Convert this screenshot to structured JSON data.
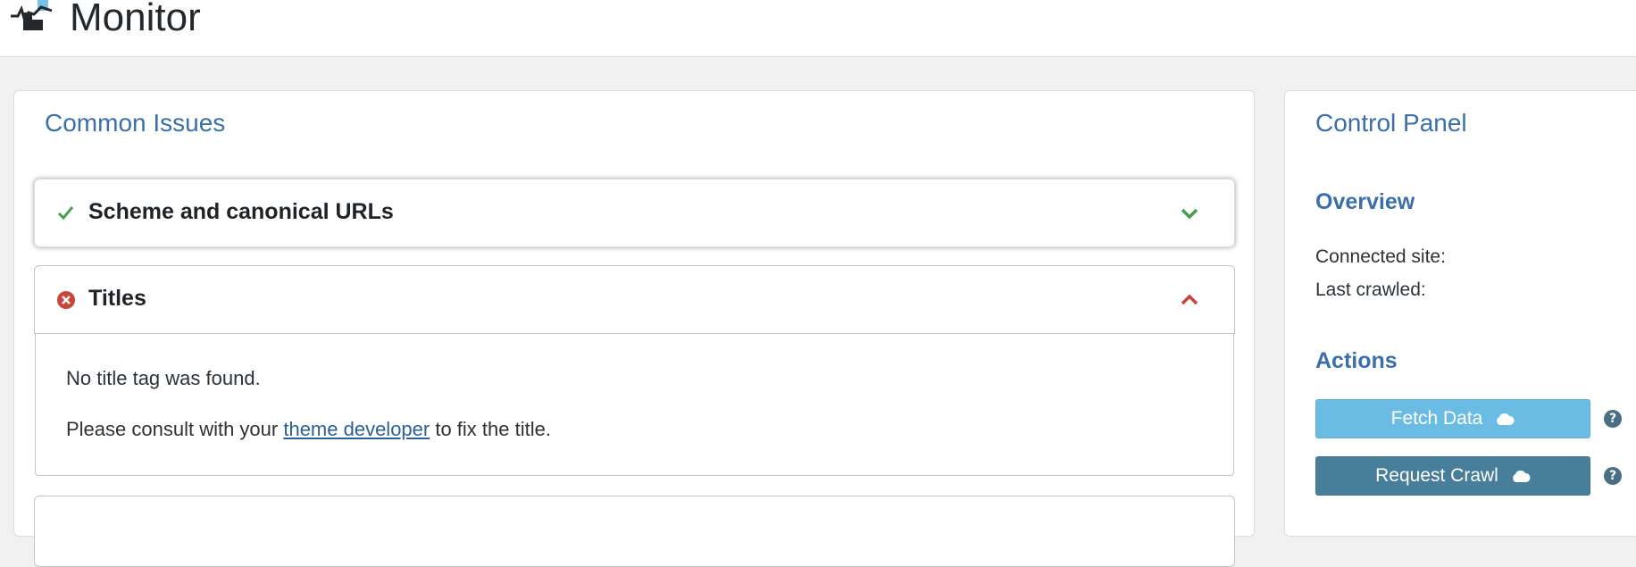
{
  "header": {
    "title": "Monitor"
  },
  "issues_card": {
    "title": "Common Issues",
    "items": [
      {
        "label": "Scheme and canonical URLs",
        "status": "pass",
        "status_icon": "check-icon",
        "chevron": "chevron-down-icon"
      },
      {
        "label": "Titles",
        "status": "fail",
        "status_icon": "error-circle-icon",
        "chevron": "chevron-up-icon"
      }
    ],
    "expanded_body": {
      "line1": "No title tag was found.",
      "line2_before": "Please consult with your ",
      "line2_link": "theme developer",
      "line2_after": " to fix the title."
    }
  },
  "control_panel": {
    "title": "Control Panel",
    "overview": {
      "heading": "Overview",
      "connected_site_label": "Connected site:",
      "last_crawled_label": "Last crawled:"
    },
    "actions": {
      "heading": "Actions",
      "fetch_label": "Fetch Data",
      "crawl_label": "Request Crawl",
      "help_glyph": "?"
    }
  },
  "colors": {
    "accent_blue": "#3a6fab",
    "success_green": "#46a049",
    "error_red": "#c9453c",
    "fetch_button": "#6bbce5",
    "crawl_button": "#477e9a",
    "help_badge": "#4a6f85"
  }
}
